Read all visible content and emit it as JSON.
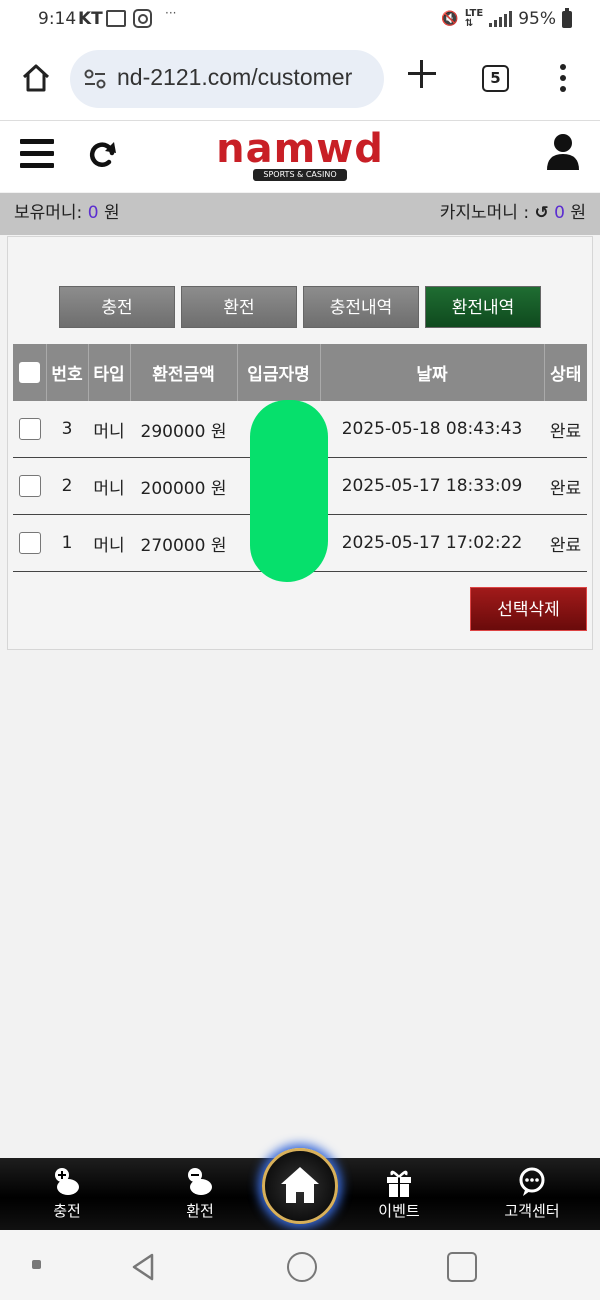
{
  "status_bar": {
    "time": "9:14",
    "carrier": "KT",
    "battery": "95%"
  },
  "browser": {
    "url": "nd-2121.com/customer",
    "tab_count": "5"
  },
  "site": {
    "logo_text": "namwd",
    "logo_sub": "SPORTS & CASINO"
  },
  "money_bar": {
    "held_label": "보유머니:",
    "held_value": "0",
    "held_unit": "원",
    "casino_label": "카지노머니 :",
    "casino_value": "0",
    "casino_unit": "원"
  },
  "tabs": [
    {
      "label": "충전",
      "active": false
    },
    {
      "label": "환전",
      "active": false
    },
    {
      "label": "충전내역",
      "active": false
    },
    {
      "label": "환전내역",
      "active": true
    }
  ],
  "table": {
    "headers": [
      "번호",
      "타입",
      "환전금액",
      "입금자명",
      "날짜",
      "상태"
    ],
    "rows": [
      {
        "no": "3",
        "type": "머니",
        "amount": "290000 원",
        "name": "",
        "date": "2025-05-18 08:43:43",
        "status": "완료"
      },
      {
        "no": "2",
        "type": "머니",
        "amount": "200000 원",
        "name": "",
        "date": "2025-05-17 18:33:09",
        "status": "완료"
      },
      {
        "no": "1",
        "type": "머니",
        "amount": "270000 원",
        "name": "",
        "date": "2025-05-17 17:02:22",
        "status": "완료"
      }
    ]
  },
  "delete_button": "선택삭제",
  "bottom_nav": [
    {
      "label": "충전",
      "icon": "piggy-plus-icon"
    },
    {
      "label": "환전",
      "icon": "piggy-minus-icon"
    },
    {
      "label": "",
      "icon": "home-icon"
    },
    {
      "label": "이벤트",
      "icon": "gift-icon"
    },
    {
      "label": "고객센터",
      "icon": "support-chat-icon"
    }
  ],
  "colors": {
    "active_tab": "#1f6d32",
    "delete_button": "#8b1212",
    "money_value": "#5b2dd0",
    "redaction": "#06e06c"
  }
}
